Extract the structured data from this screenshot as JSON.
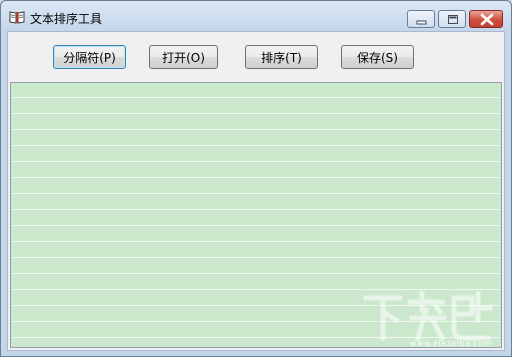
{
  "window": {
    "title": "文本排序工具",
    "icons": {
      "app": "book-icon",
      "minimize": "minimize-icon",
      "maximize": "maximize-icon",
      "close": "close-icon"
    }
  },
  "toolbar": {
    "separator_label": "分隔符(P)",
    "open_label": "打开(O)",
    "sort_label": "排序(T)",
    "save_label": "保存(S)"
  },
  "editor": {
    "value": ""
  },
  "watermark": {
    "text": "下载吧",
    "url": "www.xiazaiba.com"
  },
  "colors": {
    "editor_background": "#cbe8cc",
    "window_frame": "#c4d6ea",
    "close_button": "#c24030"
  }
}
